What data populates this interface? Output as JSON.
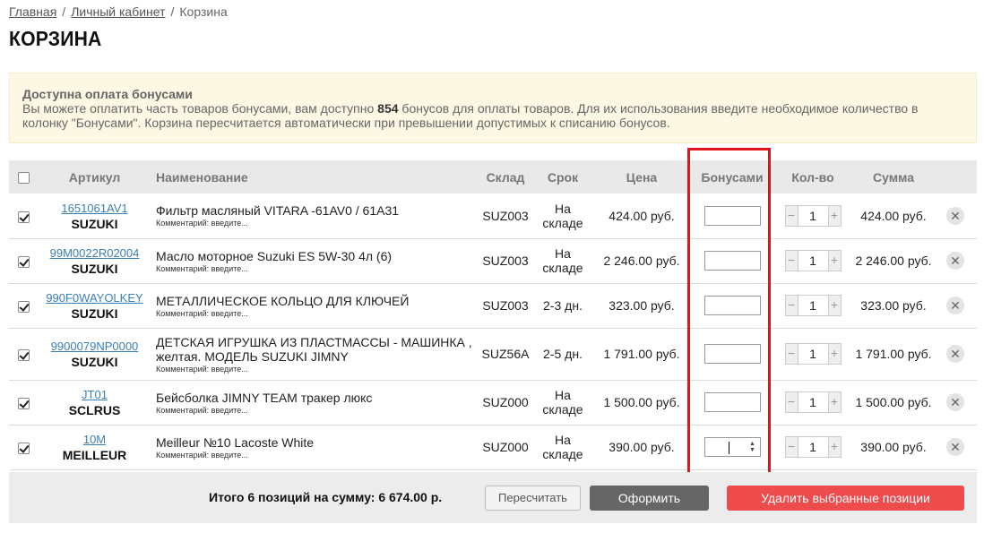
{
  "breadcrumb": {
    "home": "Главная",
    "cabinet": "Личный кабинет",
    "sep1": "/",
    "sep2": "/",
    "current": "Корзина"
  },
  "page_title": "КОРЗИНА",
  "notice": {
    "title": "Доступна оплата бонусами",
    "text_before": "Вы можете оплатить часть товаров бонусами, вам доступно",
    "bonus_count": "854",
    "text_after": "бонусов для оплаты товаров. Для их использования введите необходимое количество в колонку \"Бонусами\". Корзина пересчитается автоматически при превышении допустимых к списанию бонусов."
  },
  "headers": {
    "article": "Артикул",
    "name": "Наименование",
    "warehouse": "Склад",
    "term": "Срок",
    "price": "Цена",
    "bonus": "Бонусами",
    "qty": "Кол-во",
    "sum": "Сумма"
  },
  "comment_placeholder": "Комментарий: введите...",
  "items": [
    {
      "article": "1651061AV1",
      "brand": "SUZUKI",
      "name": "Фильтр масляный VITARA -61AV0 / 61A31",
      "comment": "Комментарий: введите...",
      "warehouse": "SUZ003",
      "term": "На складе",
      "price": "424.00 руб.",
      "qty": "1",
      "sum": "424.00 руб.",
      "checked": true
    },
    {
      "article": "99M0022R02004",
      "brand": "SUZUKI",
      "name": "Масло моторное Suzuki ES 5W-30 4л (6)",
      "comment": "Комментарий: введите...",
      "warehouse": "SUZ003",
      "term": "На складе",
      "price": "2 246.00 руб.",
      "qty": "1",
      "sum": "2 246.00 руб.",
      "checked": true
    },
    {
      "article": "990F0WAYOLKEY",
      "brand": "SUZUKI",
      "name": "МЕТАЛЛИЧЕСКОЕ КОЛЬЦО ДЛЯ КЛЮЧЕЙ",
      "comment": "Комментарий: введите...",
      "warehouse": "SUZ003",
      "term": "2-3 дн.",
      "price": "323.00 руб.",
      "qty": "1",
      "sum": "323.00 руб.",
      "checked": true
    },
    {
      "article": "9900079NP0000",
      "brand": "SUZUKI",
      "name": "ДЕТСКАЯ ИГРУШКА ИЗ ПЛАСТМАССЫ - МАШИНКА , желтая. МОДЕЛЬ SUZUKI JIMNY",
      "comment": "Комментарий: введите...",
      "warehouse": "SUZ56A",
      "term": "2-5 дн.",
      "price": "1 791.00 руб.",
      "qty": "1",
      "sum": "1 791.00 руб.",
      "checked": true
    },
    {
      "article": "JT01",
      "brand": "SCLRUS",
      "name": "Бейсболка JIMNY TEAM тракер люкс",
      "comment": "Комментарий: введите...",
      "warehouse": "SUZ000",
      "term": "На складе",
      "price": "1 500.00 руб.",
      "qty": "1",
      "sum": "1 500.00 руб.",
      "checked": true
    },
    {
      "article": "10M",
      "brand": "MEILLEUR",
      "name": "Meilleur №10 Lacoste White",
      "comment": "Комментарий: введите...",
      "warehouse": "SUZ000",
      "term": "На складе",
      "price": "390.00 руб.",
      "qty": "1",
      "sum": "390.00 руб.",
      "checked": true
    }
  ],
  "footer": {
    "total": "Итого 6 позиций на сумму: 6 674.00 р.",
    "recalc": "Пересчитать",
    "order": "Оформить",
    "delete_selected": "Удалить выбранные позиции"
  },
  "icons": {
    "minus": "−",
    "plus": "+",
    "close": "✕",
    "spin_up": "▲",
    "spin_down": "▼"
  },
  "colors": {
    "highlight": "#e3131b",
    "delete_button": "#ee4b4d",
    "order_button": "#666666",
    "notice_bg": "#fcf8e3",
    "link": "#3a7fb5"
  }
}
